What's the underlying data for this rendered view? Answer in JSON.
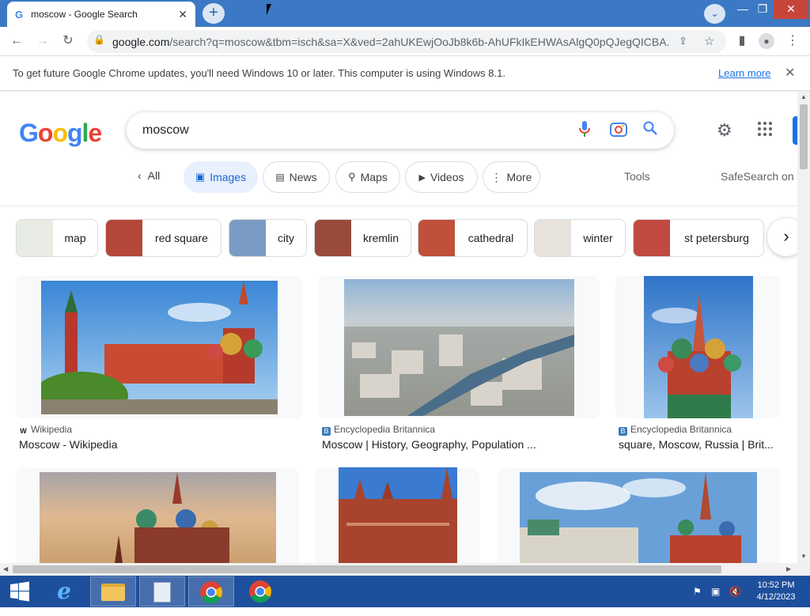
{
  "browser": {
    "tab_title": "moscow - Google Search",
    "new_tab": "+",
    "url_host": "google.com",
    "url_rest": "/search?q=moscow&tbm=isch&sa=X&ved=2ahUKEwjOoJb8k6b-AhUFkIkEHWAsAlgQ0pQJegQICBA...",
    "window_controls": {
      "minimize": "—",
      "restore": "❐",
      "close": "✕"
    }
  },
  "infobar": {
    "message": "To get future Google Chrome updates, you'll need Windows 10 or later. This computer is using Windows 8.1.",
    "link": "Learn more",
    "close": "✕"
  },
  "google": {
    "logo_letters": [
      {
        "ch": "G",
        "color": "#4285F4"
      },
      {
        "ch": "o",
        "color": "#EA4335"
      },
      {
        "ch": "o",
        "color": "#FBBC05"
      },
      {
        "ch": "g",
        "color": "#4285F4"
      },
      {
        "ch": "l",
        "color": "#34A853"
      },
      {
        "ch": "e",
        "color": "#EA4335"
      }
    ],
    "query": "moscow",
    "nav": {
      "all": "All",
      "images": "Images",
      "news": "News",
      "maps": "Maps",
      "videos": "Videos",
      "more": "More",
      "tools": "Tools",
      "safesearch": "SafeSearch on"
    },
    "related": [
      {
        "label": "map",
        "thumb": "#e8ece4"
      },
      {
        "label": "red square",
        "thumb": "#b5463a"
      },
      {
        "label": "city",
        "thumb": "#7a9cc4"
      },
      {
        "label": "kremlin",
        "thumb": "#9a4a3a"
      },
      {
        "label": "cathedral",
        "thumb": "#c0503a"
      },
      {
        "label": "winter",
        "thumb": "#e8e2dc"
      },
      {
        "label": "st petersburg",
        "thumb": "#c04a40"
      }
    ],
    "results": [
      {
        "source": "Wikipedia",
        "title": "Moscow - Wikipedia",
        "fav": "W"
      },
      {
        "source": "Encyclopedia Britannica",
        "title": "Moscow | History, Geography, Population ...",
        "fav": "B"
      },
      {
        "source": "Encyclopedia Britannica",
        "title": "square, Moscow, Russia | Brit...",
        "fav": "B"
      }
    ]
  },
  "taskbar": {
    "time": "10:52 PM",
    "date": "4/12/2023"
  }
}
